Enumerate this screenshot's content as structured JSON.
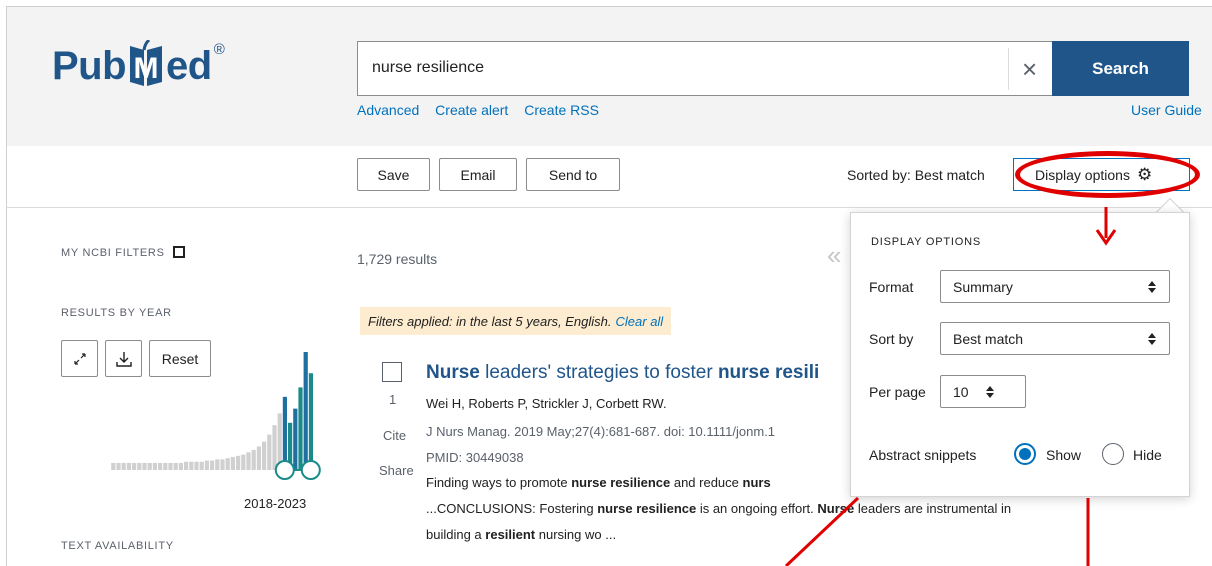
{
  "logo": {
    "text_left": "Pub",
    "text_right": "ed",
    "registered": "®"
  },
  "search": {
    "value": "nurse resilience",
    "clear_label": "×",
    "button_label": "Search"
  },
  "search_links": [
    "Advanced",
    "Create alert",
    "Create RSS"
  ],
  "user_guide": "User Guide",
  "toolbar": {
    "buttons": [
      "Save",
      "Email",
      "Send to"
    ],
    "sorted_by": "Sorted by: Best match",
    "display_options": "Display options"
  },
  "sidebar": {
    "my_ncbi_filters": "MY NCBI FILTERS",
    "results_by_year": "RESULTS BY YEAR",
    "reset": "Reset",
    "year_range": "2018-2023",
    "text_availability": "TEXT AVAILABILITY"
  },
  "results": {
    "count": "1,729 results",
    "filters_applied": "Filters applied: in the last 5 years, English.",
    "clear_all": "Clear all",
    "item": {
      "number": "1",
      "cite": "Cite",
      "share": "Share",
      "title_prefix": "Nurse",
      "title_mid": " leaders' strategies to foster ",
      "title_bold": "nurse resili",
      "authors": "Wei H, Roberts P, Strickler J, Corbett RW.",
      "citation": "J Nurs Manag. 2019 May;27(4):681-687. doi: 10.1111/jonm.1",
      "pmid": "PMID: 30449038",
      "snippet_1a": "Finding ways to promote ",
      "snippet_1b": "nurse resilience",
      "snippet_1c": " and reduce ",
      "snippet_1d": "nurs",
      "snippet_2a": "...CONCLUSIONS: Fostering ",
      "snippet_2b": "nurse resilience",
      "snippet_2c": " is an ongoing effort. ",
      "snippet_2d": "Nurse",
      "snippet_2e": " leaders are instrumental in",
      "snippet_3a": "building a ",
      "snippet_3b": "resilient",
      "snippet_3c": " nursing wo ..."
    }
  },
  "display_popup": {
    "title": "DISPLAY OPTIONS",
    "format_label": "Format",
    "format_value": "Summary",
    "sort_label": "Sort by",
    "sort_value": "Best match",
    "per_page_label": "Per page",
    "per_page_value": "10",
    "snippets_label": "Abstract snippets",
    "show_label": "Show",
    "hide_label": "Hide"
  },
  "histogram": {
    "values": [
      0.06,
      0.06,
      0.06,
      0.06,
      0.06,
      0.06,
      0.06,
      0.06,
      0.06,
      0.06,
      0.06,
      0.06,
      0.06,
      0.06,
      0.07,
      0.07,
      0.07,
      0.07,
      0.08,
      0.08,
      0.09,
      0.09,
      0.1,
      0.11,
      0.12,
      0.13,
      0.15,
      0.17,
      0.2,
      0.24,
      0.3,
      0.38,
      0.48,
      0.62,
      0.4,
      0.52,
      0.7,
      1.0,
      0.82
    ],
    "highlight_from_index": 33
  },
  "colors": {
    "brand": "#20558a",
    "link": "#0071bc",
    "annotation": "#e00000",
    "hist_active": "#1a8a8a"
  }
}
